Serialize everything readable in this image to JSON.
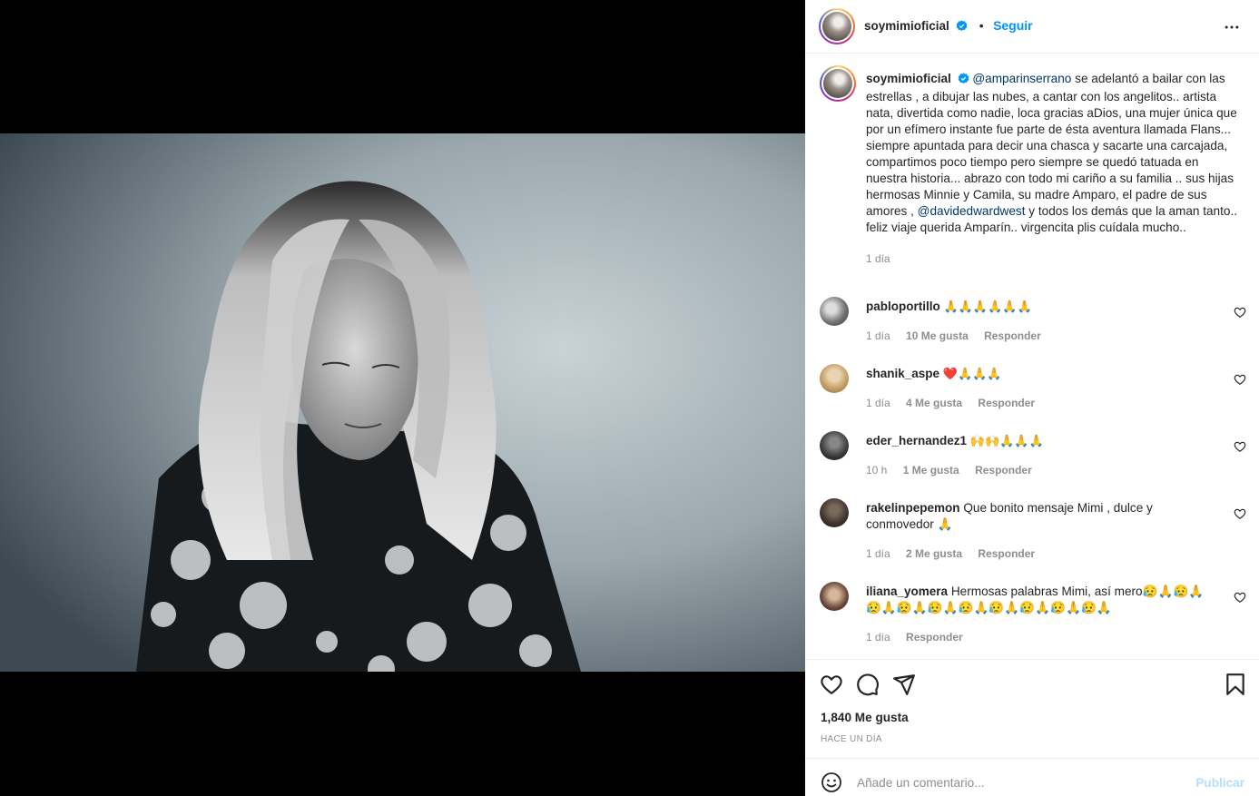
{
  "post": {
    "image_alt": "Black and white photo of a woman with long wavy blonde hair looking down, wearing a floral blouse",
    "author": "soymimioficial",
    "separator": "•",
    "follow_label": "Seguir"
  },
  "caption": {
    "author": "soymimioficial",
    "mention1": "@amparinserrano",
    "text1": " se adelantó a bailar con las estrellas , a dibujar las nubes, a cantar con los angelitos.. artista nata, divertida como nadie, loca gracias aDios, una mujer única que por un efímero instante fue parte de ésta aventura llamada Flans... siempre apuntada para decir una chasca y sacarte una carcajada, compartimos poco tiempo pero siempre se quedó tatuada en nuestra historia... abrazo con todo mi cariño a su familia .. sus hijas hermosas Minnie y Camila, su madre Amparo, el padre de sus amores , ",
    "mention2": "@davidedwardwest",
    "text2": " y todos los demás que la aman tanto.. feliz viaje querida Amparín.. virgencita plis cuídala mucho..",
    "time": "1 día"
  },
  "comments": [
    {
      "user": "pabloportillo",
      "text": "🙏🙏🙏🙏🙏🙏",
      "time": "1 día",
      "likes": "10 Me gusta",
      "reply": "Responder"
    },
    {
      "user": "shanik_aspe",
      "text": "❤️🙏🙏🙏",
      "time": "1 día",
      "likes": "4 Me gusta",
      "reply": "Responder"
    },
    {
      "user": "eder_hernandez1",
      "text": "🙌🙌🙏🙏🙏",
      "time": "10 h",
      "likes": "1 Me gusta",
      "reply": "Responder"
    },
    {
      "user": "rakelinpepemon",
      "text": "Que bonito mensaje Mimi , dulce y conmovedor 🙏",
      "time": "1 día",
      "likes": "2 Me gusta",
      "reply": "Responder"
    },
    {
      "user": "iliana_yomera",
      "text": "Hermosas palabras Mimi, así mero😥🙏😥🙏😥🙏😥🙏😥🙏😥🙏😥🙏😥🙏😥🙏😥🙏",
      "time": "1 día",
      "likes": "",
      "reply": "Responder"
    }
  ],
  "footer": {
    "likes": "1,840 Me gusta",
    "time": "HACE UN DÍA",
    "comment_placeholder": "Añade un comentario...",
    "post_label": "Publicar"
  },
  "icons": {
    "verified": "verified-badge-icon",
    "more": "more-options-icon",
    "like": "heart-icon",
    "comment": "comment-icon",
    "share": "share-icon",
    "save": "bookmark-icon",
    "emoji": "emoji-icon"
  },
  "colors": {
    "accent": "#0095f6",
    "mention": "#00376b",
    "muted": "#8e8e8e",
    "post_disabled": "#b2dffc"
  }
}
